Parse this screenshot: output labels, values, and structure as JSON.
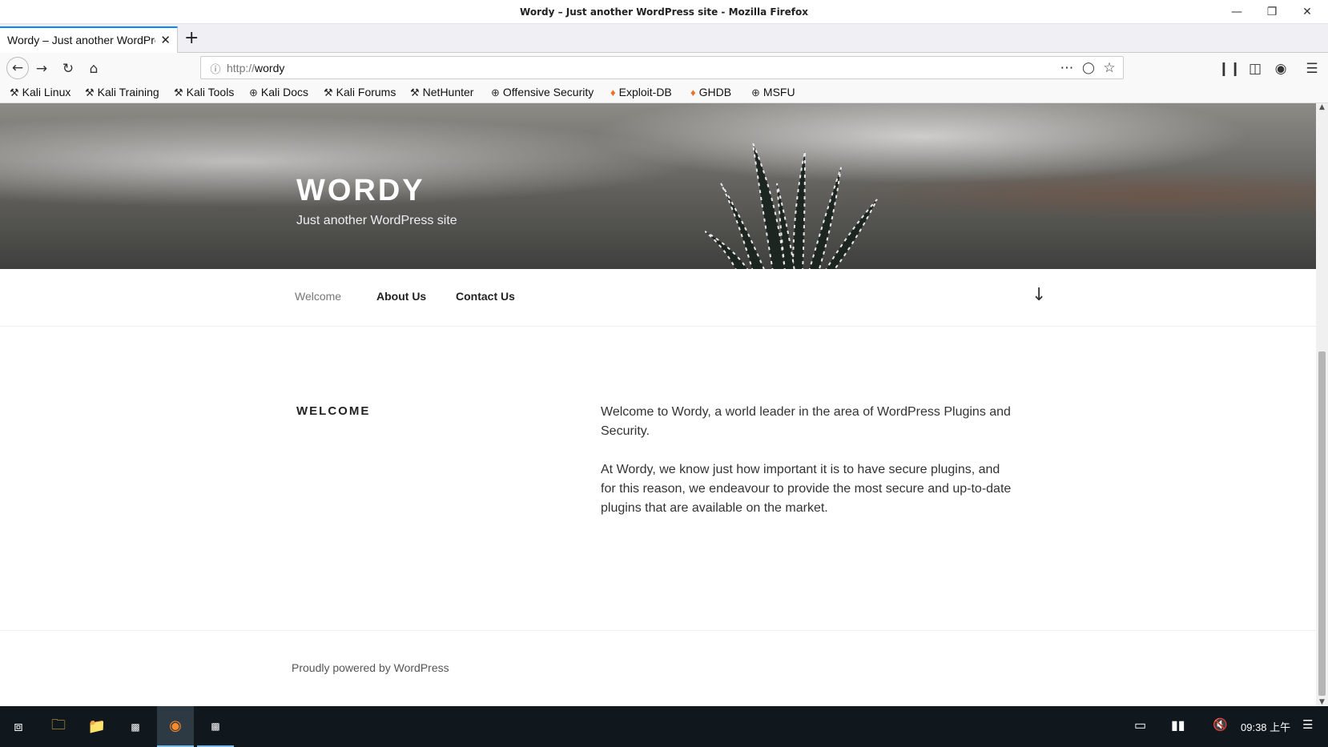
{
  "window": {
    "title": "Wordy – Just another WordPress site - Mozilla Firefox"
  },
  "tab": {
    "label": "Wordy – Just another WordPress site",
    "close": "✕",
    "new_tab": "+"
  },
  "url": {
    "protocol": "http://",
    "host": "wordy"
  },
  "bookmarks": [
    {
      "label": "Kali Linux",
      "icon": "kali-dragon-icon"
    },
    {
      "label": "Kali Training",
      "icon": "kali-dragon-icon"
    },
    {
      "label": "Kali Tools",
      "icon": "kali-dragon-icon"
    },
    {
      "label": "Kali Docs",
      "icon": "globe-icon"
    },
    {
      "label": "Kali Forums",
      "icon": "kali-dragon-icon"
    },
    {
      "label": "NetHunter",
      "icon": "kali-dragon-icon"
    },
    {
      "label": "Offensive Security",
      "icon": "globe-icon"
    },
    {
      "label": "Exploit-DB",
      "icon": "exploitdb-icon"
    },
    {
      "label": "GHDB",
      "icon": "exploitdb-icon"
    },
    {
      "label": "MSFU",
      "icon": "globe-icon"
    }
  ],
  "site": {
    "title": "WORDY",
    "description": "Just another WordPress site"
  },
  "menu": {
    "items": [
      "Welcome",
      "About Us",
      "Contact Us"
    ],
    "current": "Welcome"
  },
  "entry": {
    "title": "WELCOME",
    "paragraphs": [
      "Welcome to Wordy, a world leader in the area of WordPress Plugins and Security.",
      "At Wordy, we know just how important it is to have secure plugins, and for this reason, we endeavour to provide the most secure and up-to-date plugins that are available on the market."
    ]
  },
  "footer": {
    "powered": "Proudly powered by WordPress"
  },
  "taskbar": {
    "clock": "09:38 上午"
  },
  "colors": {
    "accent": "#0a84ff",
    "taskbar": "#10181e"
  }
}
